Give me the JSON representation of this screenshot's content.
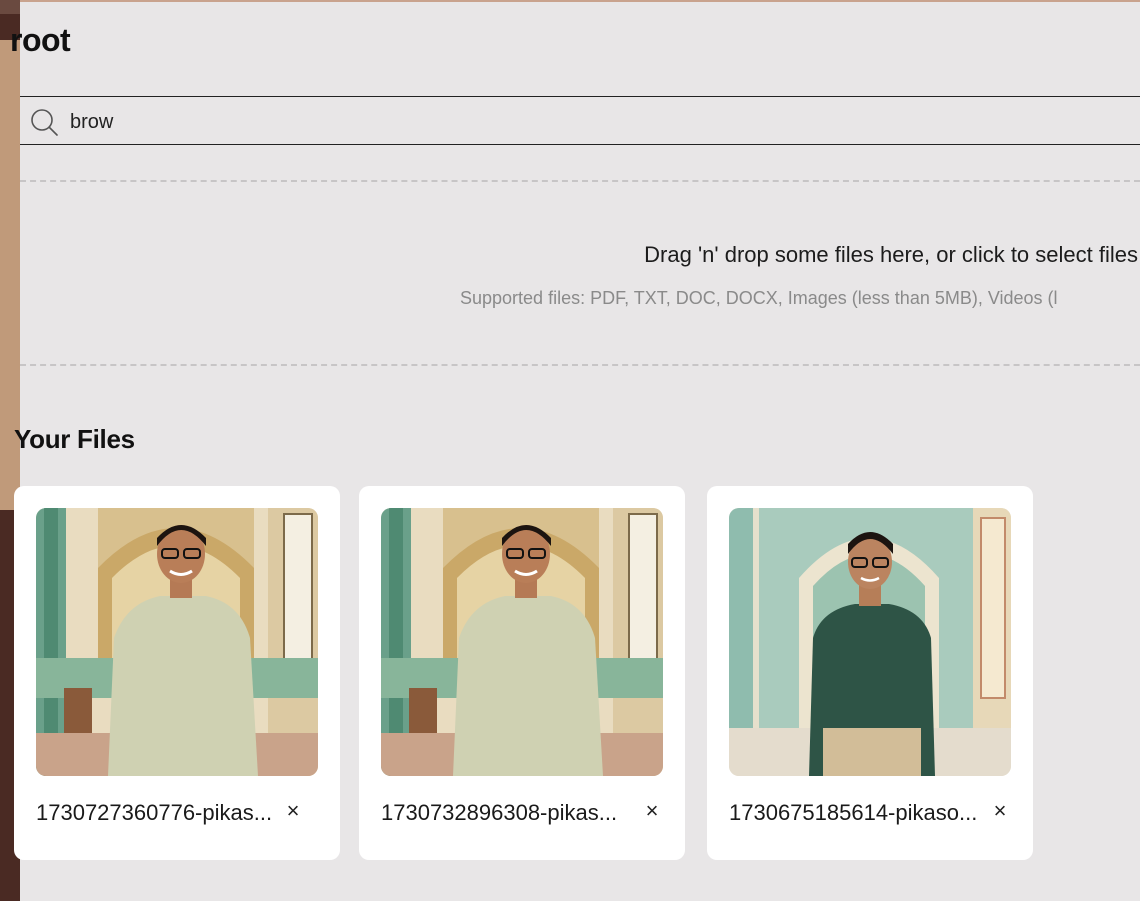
{
  "page": {
    "title": "root"
  },
  "search": {
    "value": "brow",
    "icon": "search-icon"
  },
  "dropzone": {
    "main_text": "Drag 'n' drop some files here, or click to select files",
    "sub_text": "Supported files: PDF, TXT, DOC, DOCX, Images (less than 5MB), Videos (l"
  },
  "files_section": {
    "title": "Your Files",
    "files": [
      {
        "name": "1730727360776-pikas...",
        "remove_label": "×"
      },
      {
        "name": "1730732896308-pikas...",
        "remove_label": "×"
      },
      {
        "name": "1730675185614-pikaso...",
        "remove_label": "×"
      }
    ]
  },
  "colors": {
    "background": "#e8e6e7",
    "card": "#ffffff",
    "left_strip": "#4a2a23",
    "muted_text": "#8a8a8a"
  }
}
